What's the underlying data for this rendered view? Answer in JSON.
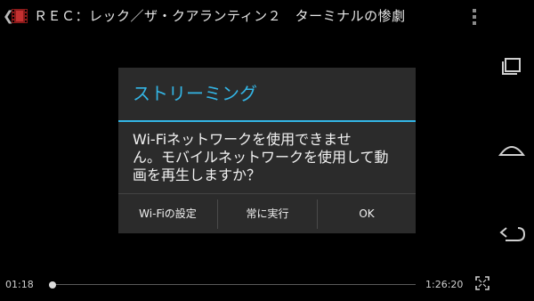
{
  "header": {
    "title": "ＲＥＣ：レック／ザ・クアランティン２　ターミナルの惨劇",
    "back_icon": "chevron-left-icon",
    "app_icon": "film-icon",
    "menu_icon": "overflow-menu-icon"
  },
  "dialog": {
    "title": "ストリーミング",
    "message_lines": [
      "Wi-Fiネットワークを使用できませ",
      "ん。モバイルネットワークを使用して動",
      "画を再生しますか？"
    ],
    "buttons": {
      "wifi_settings": "Wi-Fiの設定",
      "always_run": "常に実行",
      "ok": "OK"
    },
    "accent_color": "#33b5e5"
  },
  "player": {
    "current_time": "01:18",
    "total_time": "1:26:20",
    "progress": 0.015,
    "fullscreen_icon": "fullscreen-icon"
  },
  "nav": {
    "icons": [
      "recent-apps-icon",
      "home-icon",
      "back-icon"
    ]
  }
}
